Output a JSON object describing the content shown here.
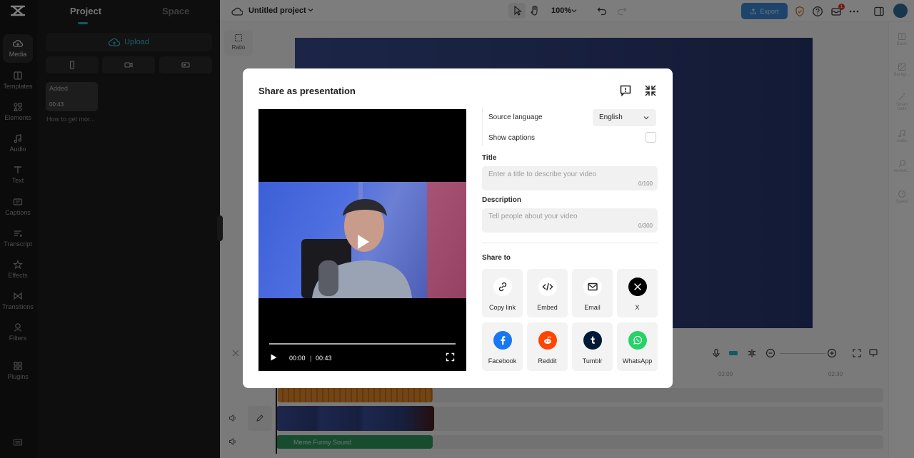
{
  "sidebar": {
    "items": [
      {
        "label": "Media",
        "icon": "cloud-icon"
      },
      {
        "label": "Templates",
        "icon": "templates-icon"
      },
      {
        "label": "Elements",
        "icon": "elements-icon"
      },
      {
        "label": "Audio",
        "icon": "music-icon"
      },
      {
        "label": "Text",
        "icon": "text-icon"
      },
      {
        "label": "Captions",
        "icon": "captions-icon"
      },
      {
        "label": "Transcript",
        "icon": "transcript-icon"
      },
      {
        "label": "Effects",
        "icon": "effects-icon"
      },
      {
        "label": "Transitions",
        "icon": "transitions-icon"
      },
      {
        "label": "Filters",
        "icon": "filters-icon"
      },
      {
        "label": "Plugins",
        "icon": "plugins-icon"
      }
    ]
  },
  "media_panel": {
    "tabs": [
      "Project",
      "Space"
    ],
    "upload_label": "Upload",
    "item": {
      "badge": "Added",
      "duration": "00:43",
      "name": "How to get mor..."
    }
  },
  "topbar": {
    "project_title": "Untitled project",
    "zoom": "100%",
    "export_label": "Export",
    "notification_count": "1"
  },
  "canvas": {
    "ratio_label": "Ratio"
  },
  "right_rail": {
    "items": [
      "Basic",
      "Backgr...",
      "Smart tools",
      "Audio",
      "Animat...",
      "Speed"
    ]
  },
  "timeline": {
    "ruler": [
      "02:00",
      "02:30"
    ],
    "sound_clip_label": "Meme Funny Sound"
  },
  "modal": {
    "title": "Share as presentation",
    "player": {
      "current_time": "00:00",
      "separator": "|",
      "duration": "00:43"
    },
    "source_language_label": "Source language",
    "source_language_value": "English",
    "show_captions_label": "Show captions",
    "title_label": "Title",
    "title_placeholder": "Enter a title to describe your video",
    "title_counter": "0/100",
    "description_label": "Description",
    "description_placeholder": "Tell people about your video",
    "description_counter": "0/300",
    "share_to_label": "Share to",
    "share_options": [
      {
        "label": "Copy link",
        "icon": "link-icon",
        "color": "#ffffff"
      },
      {
        "label": "Embed",
        "icon": "code-icon",
        "color": "#ffffff"
      },
      {
        "label": "Email",
        "icon": "mail-icon",
        "color": "#ffffff"
      },
      {
        "label": "X",
        "icon": "x-logo-icon",
        "color": "#000000"
      },
      {
        "label": "Facebook",
        "icon": "facebook-icon",
        "color": "#1877f2"
      },
      {
        "label": "Reddit",
        "icon": "reddit-icon",
        "color": "#ff4500"
      },
      {
        "label": "Tumblr",
        "icon": "tumblr-icon",
        "color": "#001935"
      },
      {
        "label": "WhatsApp",
        "icon": "whatsapp-icon",
        "color": "#25d366"
      }
    ]
  }
}
